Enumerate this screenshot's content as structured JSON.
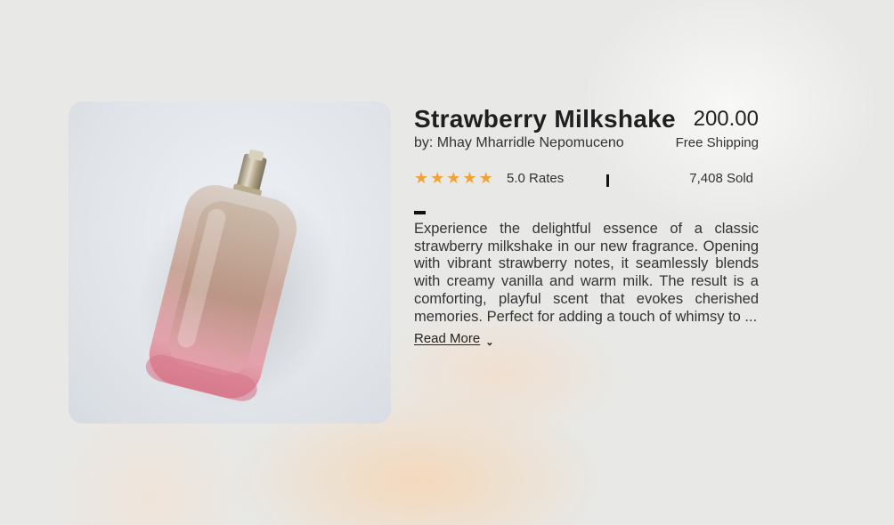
{
  "product": {
    "title": "Strawberry Milkshake",
    "price": "200.00",
    "author": "by: Mhay Mharridle Nepomuceno",
    "shipping": "Free Shipping",
    "rating_stars": 5,
    "rating_text": "5.0 Rates",
    "sold": "7,408 Sold",
    "description": "Experience the delightful essence of a classic strawberry milkshake in our new fragrance. Opening with vibrant strawberry notes, it seamlessly blends with creamy vanilla and warm milk. The result is a comforting, playful scent that evokes cherished memories. Perfect for adding a touch of whimsy to ...",
    "read_more": "Read More"
  },
  "colors": {
    "star": "#f0a33a",
    "bottle_pink": "#d98c95",
    "cap_gold": "#b7a88a",
    "background": "#e8e8e6"
  },
  "icons": {
    "star": "star-icon",
    "read_more_chevron": "chevron-down-icon"
  }
}
